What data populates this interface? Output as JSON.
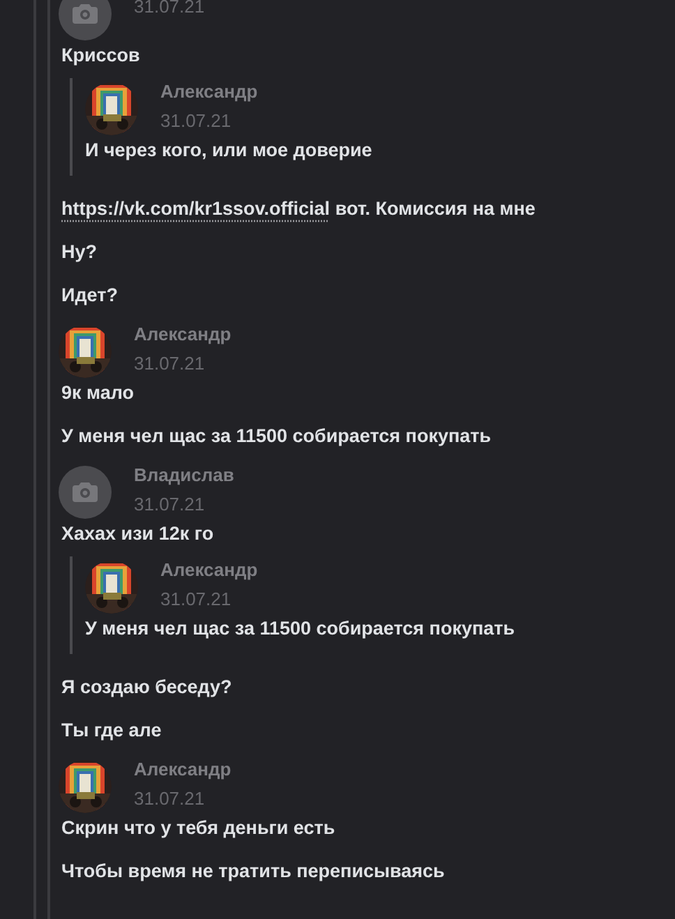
{
  "messages": [
    {
      "kind": "header",
      "avatar": {
        "kind": "camera"
      },
      "date": "31.07.21"
    },
    {
      "kind": "text",
      "text": "Криссов"
    },
    {
      "kind": "quote",
      "name": "Александр",
      "date": "31.07.21",
      "text": "И через кого, или мое доверие"
    },
    {
      "kind": "text",
      "link": "https://vk.com/kr1ssov.official",
      "text": "вот. Комиссия на мне"
    },
    {
      "kind": "text",
      "text": "Ну?"
    },
    {
      "kind": "text",
      "text": "Идет?"
    },
    {
      "kind": "header",
      "name": "Александр",
      "date": "31.07.21"
    },
    {
      "kind": "text",
      "text": "9к мало"
    },
    {
      "kind": "text",
      "text": "У меня чел щас за 11500 собирается покупать"
    },
    {
      "kind": "header",
      "avatar": {
        "kind": "camera"
      },
      "name": "Владислав",
      "date": "31.07.21"
    },
    {
      "kind": "text",
      "text": "Хахах изи 12к го"
    },
    {
      "kind": "quote",
      "name": "Александр",
      "date": "31.07.21",
      "text": "У меня чел щас за 11500 собирается покупать"
    },
    {
      "kind": "text",
      "text": "Я создаю беседу?"
    },
    {
      "kind": "text",
      "text": "Ты где але"
    },
    {
      "kind": "header",
      "name": "Александр",
      "date": "31.07.21"
    },
    {
      "kind": "text",
      "text": "Скрин что у тебя деньги есть"
    },
    {
      "kind": "text",
      "text": "Чтобы время не тратить переписываясь"
    }
  ]
}
